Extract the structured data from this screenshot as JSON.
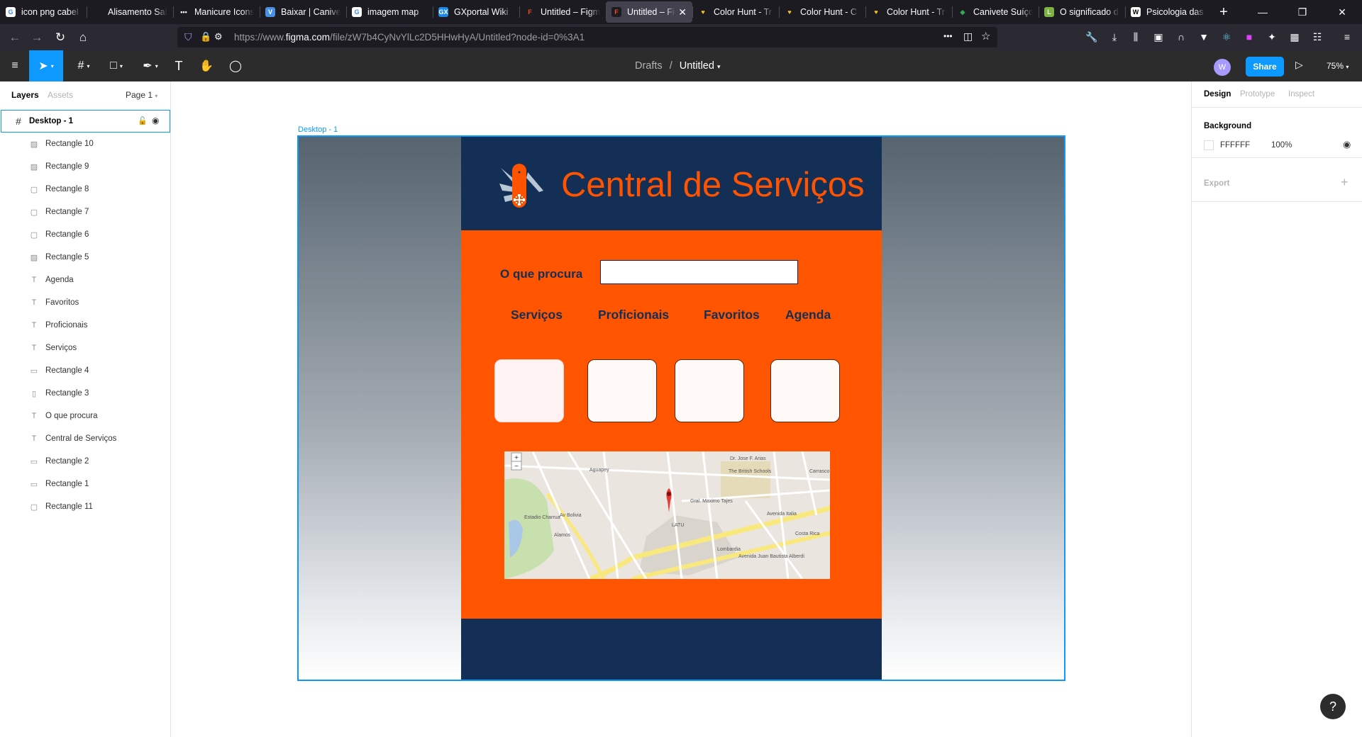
{
  "browser": {
    "tabs": [
      {
        "title": "icon png cabel",
        "favicon": "G",
        "color": "#ffffff",
        "text_color": "#4285f4"
      },
      {
        "title": "Alisamento Sal",
        "favicon": "",
        "color": "#1c1b22",
        "text_color": "#ffffff"
      },
      {
        "title": "Manicure Icons",
        "favicon": "•••",
        "color": "#1c1b22",
        "text_color": "#ffffff"
      },
      {
        "title": "Baixar | Canivet",
        "favicon": "V",
        "color": "#4a90e2",
        "text_color": "#ffffff"
      },
      {
        "title": "imagem map",
        "favicon": "G",
        "color": "#ffffff",
        "text_color": "#4285f4"
      },
      {
        "title": "GXportal Wiki",
        "favicon": "GX",
        "color": "#1e88e5",
        "text_color": "#ffffff"
      },
      {
        "title": "Untitled – Figma",
        "favicon": "F",
        "color": "#1c1b22",
        "text_color": "#f24e1e"
      },
      {
        "title": "Untitled – Figma",
        "favicon": "F",
        "color": "#1c1b22",
        "text_color": "#f24e1e",
        "active": true
      },
      {
        "title": "Color Hunt - Tr",
        "favicon": "♥",
        "color": "#1c1b22",
        "text_color": "#f5c518"
      },
      {
        "title": "Color Hunt - C",
        "favicon": "♥",
        "color": "#1c1b22",
        "text_color": "#f5c518"
      },
      {
        "title": "Color Hunt - Tr",
        "favicon": "♥",
        "color": "#1c1b22",
        "text_color": "#f5c518"
      },
      {
        "title": "Canivete Suíço",
        "favicon": "◆",
        "color": "#1c1b22",
        "text_color": "#34a853"
      },
      {
        "title": "O significado d",
        "favicon": "L",
        "color": "#7cb342",
        "text_color": "#ffffff"
      },
      {
        "title": "Psicologia das",
        "favicon": "W",
        "color": "#ffffff",
        "text_color": "#000000"
      }
    ],
    "new_tab": "+",
    "url_prefix": "https://www.",
    "url_host": "figma.com",
    "url_path": "/file/zW7b4CyNvYlLc2D5HHwHyA/Untitled?node-id=0%3A1",
    "url_menu": "•••"
  },
  "figma": {
    "breadcrumb_parent": "Drafts",
    "breadcrumb_sep": "/",
    "file_name": "Untitled",
    "avatar_letter": "W",
    "share": "Share",
    "zoom": "75%",
    "left_tabs": {
      "layers": "Layers",
      "assets": "Assets",
      "page": "Page 1"
    },
    "layers": [
      {
        "name": "Desktop - 1",
        "icon": "frame-icon",
        "glyph": "#",
        "top": true
      },
      {
        "name": "Rectangle 10",
        "icon": "image-icon",
        "glyph": "▨"
      },
      {
        "name": "Rectangle 9",
        "icon": "image-icon",
        "glyph": "▨"
      },
      {
        "name": "Rectangle 8",
        "icon": "rectangle-icon",
        "glyph": "▢"
      },
      {
        "name": "Rectangle 7",
        "icon": "rectangle-icon",
        "glyph": "▢"
      },
      {
        "name": "Rectangle 6",
        "icon": "rectangle-icon",
        "glyph": "▢"
      },
      {
        "name": "Rectangle 5",
        "icon": "image-icon",
        "glyph": "▨"
      },
      {
        "name": "Agenda",
        "icon": "text-icon",
        "glyph": "T"
      },
      {
        "name": "Favoritos",
        "icon": "text-icon",
        "glyph": "T"
      },
      {
        "name": "Proficionais",
        "icon": "text-icon",
        "glyph": "T"
      },
      {
        "name": "Serviços",
        "icon": "text-icon",
        "glyph": "T"
      },
      {
        "name": "Rectangle 4",
        "icon": "rectangle-icon",
        "glyph": "▭"
      },
      {
        "name": "Rectangle 3",
        "icon": "rectangle-icon",
        "glyph": "▯"
      },
      {
        "name": "O que procura",
        "icon": "text-icon",
        "glyph": "T"
      },
      {
        "name": "Central de Serviços",
        "icon": "text-icon",
        "glyph": "T"
      },
      {
        "name": "Rectangle 2",
        "icon": "rectangle-icon",
        "glyph": "▭"
      },
      {
        "name": "Rectangle 1",
        "icon": "rectangle-icon",
        "glyph": "▭"
      },
      {
        "name": "Rectangle 11",
        "icon": "rectangle-icon",
        "glyph": "▢"
      }
    ],
    "right_tabs": {
      "design": "Design",
      "prototype": "Prototype",
      "inspect": "Inspect"
    },
    "background_title": "Background",
    "background_hex": "FFFFFF",
    "background_opacity": "100%",
    "export_title": "Export",
    "help": "?"
  },
  "frame": {
    "label": "Desktop - 1",
    "title": "Central de Serviços",
    "search_label": "O que procura",
    "search_value": "",
    "nav": [
      "Serviços",
      "Proficionais",
      "Favoritos",
      "Agenda"
    ],
    "colors": {
      "navy": "#132f55",
      "orange": "#ff5500",
      "title": "#ff5300"
    },
    "map": {
      "labels": [
        "Estadio Charrua",
        "The British Schools",
        "LATU",
        "Avenida Italia",
        "Av Bolivia",
        "Gral. Maximo Tajes",
        "Carrasco Norte",
        "Dr. Jose F. Arias",
        "Avenida Juan Bautista Alberdi",
        "Costa Rica",
        "Lombardia",
        "Alamos",
        "Aguapey"
      ]
    }
  }
}
